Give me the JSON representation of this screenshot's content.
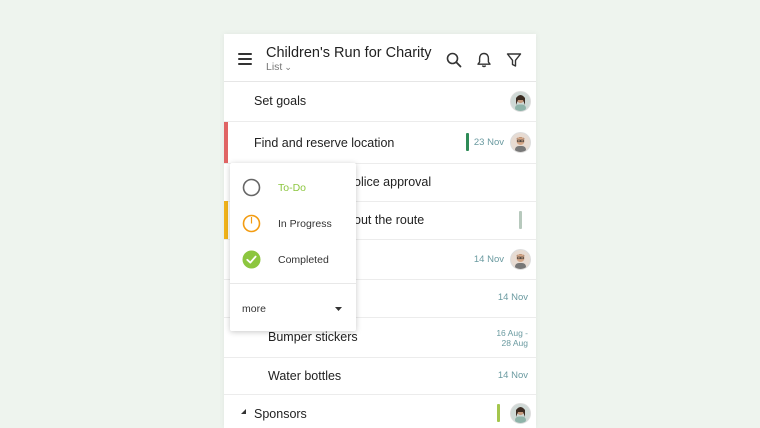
{
  "header": {
    "title": "Children's Run for Charity",
    "view": "List"
  },
  "rows": [
    {
      "label": "Set goals",
      "date": "",
      "bar": "",
      "prio": ""
    },
    {
      "label": "Find and reserve location",
      "date": "23 Nov",
      "bar": "#e06464",
      "prio": "#2e8b57"
    },
    {
      "label": "olice approval",
      "date": "",
      "bar": "",
      "prio": ""
    },
    {
      "label": "out the route",
      "date": "",
      "bar": "#f1b31a",
      "prio": "#b7c9bd"
    },
    {
      "label": "",
      "date": "14 Nov",
      "bar": "",
      "prio": ""
    },
    {
      "label": "",
      "date": "14 Nov",
      "bar": "",
      "prio": ""
    },
    {
      "label": "Bumper stickers",
      "date_line1": "16 Aug -",
      "date_line2": "28 Aug"
    },
    {
      "label": "Water bottles",
      "date": "14 Nov"
    },
    {
      "label": "Sponsors",
      "date": "",
      "prio": "#a4c64d"
    }
  ],
  "status_menu": {
    "options": [
      {
        "label": "To-Do",
        "color": "#8cc63f"
      },
      {
        "label": "In Progress",
        "color": "#333333"
      },
      {
        "label": "Completed",
        "color": "#333333"
      }
    ],
    "more_label": "more"
  },
  "colors": {
    "todo_ring": "#666666",
    "inprogress_ring": "#f39c12",
    "completed_fill": "#8cc63f"
  }
}
